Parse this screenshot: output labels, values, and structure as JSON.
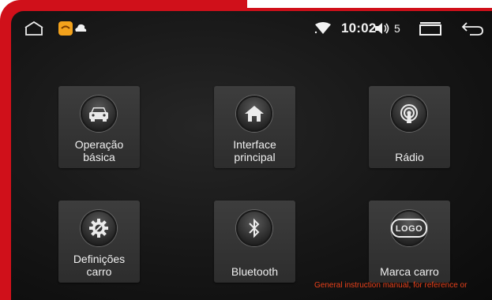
{
  "statusbar": {
    "icons": [
      "home-outline-icon",
      "app-notification-icon",
      "cloud-icon",
      "wifi-icon",
      "volume-icon",
      "recent-apps-icon",
      "back-icon"
    ],
    "time": "10:02",
    "volume_level": "5"
  },
  "tiles": [
    {
      "icon": "car-icon",
      "label_line1": "Operação",
      "label_line2": "básica"
    },
    {
      "icon": "home-icon",
      "label_line1": "Interface",
      "label_line2": "principal"
    },
    {
      "icon": "radio-icon",
      "label_line1": "",
      "label_line2": "Rádio"
    },
    {
      "icon": "settings-gear-icon",
      "label_line1": "Definições",
      "label_line2": "carro"
    },
    {
      "icon": "bluetooth-icon",
      "label_line1": "",
      "label_line2": "Bluetooth"
    },
    {
      "icon": "logo-icon",
      "label_line1": "",
      "label_line2": "Marca carro",
      "logo_text": "LOGO"
    }
  ],
  "footer_note": "General instruction manual, for reference or",
  "colors": {
    "frame": "#d0101a",
    "screen_bg": "#161616",
    "tile_bg": "#353535",
    "note": "#e8401a"
  }
}
